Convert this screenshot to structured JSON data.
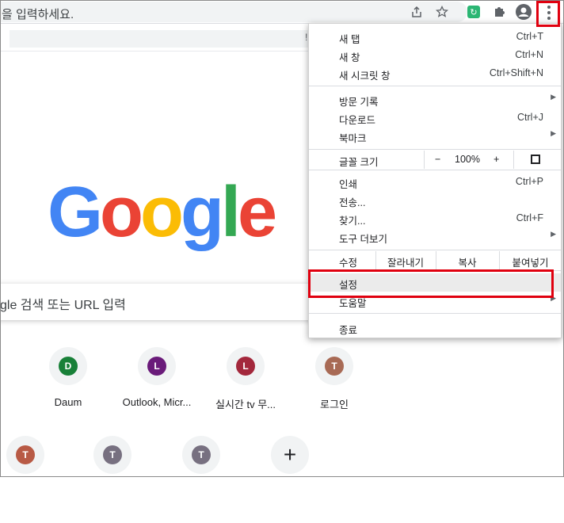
{
  "omnibox": {
    "placeholder_text": "을 입력하세요.",
    "icons": [
      "share-icon",
      "star-icon",
      "extension-green-icon",
      "puzzle-icon",
      "profile-icon",
      "kebab-menu-icon"
    ]
  },
  "bookmarks_bar": {
    "overflow_text": "!"
  },
  "google_logo": {
    "letters": [
      "G",
      "o",
      "o",
      "g",
      "l",
      "e"
    ],
    "colors": [
      "#4285f4",
      "#ea4335",
      "#fbbc05",
      "#4285f4",
      "#34a853",
      "#ea4335"
    ]
  },
  "search": {
    "placeholder": "gle 검색 또는 URL 입력"
  },
  "shortcuts": [
    {
      "letter": "D",
      "label": "Daum",
      "color": "#188038"
    },
    {
      "letter": "L",
      "label": "Outlook, Micr...",
      "color": "#6a1b7a"
    },
    {
      "letter": "L",
      "label": "실시간 tv 무...",
      "color": "#a3283c"
    },
    {
      "letter": "T",
      "label": "로그인",
      "color": "#a86a55"
    },
    {
      "letter": "T",
      "label": "",
      "color": "#b85a45"
    },
    {
      "letter": "T",
      "label": "",
      "color": "#777080"
    },
    {
      "letter": "T",
      "label": "",
      "color": "#777080"
    },
    {
      "letter": "+",
      "label": "",
      "color": ""
    }
  ],
  "menu": {
    "new_tab": {
      "label": "새 탭",
      "shortcut": "Ctrl+T"
    },
    "new_window": {
      "label": "새 창",
      "shortcut": "Ctrl+N"
    },
    "incognito": {
      "label": "새 시크릿 창",
      "shortcut": "Ctrl+Shift+N"
    },
    "history": {
      "label": "방문 기록"
    },
    "downloads": {
      "label": "다운로드",
      "shortcut": "Ctrl+J"
    },
    "bookmarks": {
      "label": "북마크"
    },
    "zoom": {
      "label": "글꼴 크기",
      "minus": "−",
      "value": "100%",
      "plus": "+"
    },
    "print": {
      "label": "인쇄",
      "shortcut": "Ctrl+P"
    },
    "cast": {
      "label": "전송..."
    },
    "find": {
      "label": "찾기...",
      "shortcut": "Ctrl+F"
    },
    "more_tools": {
      "label": "도구 더보기"
    },
    "edit": {
      "label": "수정",
      "cut": "잘라내기",
      "copy": "복사",
      "paste": "붙여넣기"
    },
    "settings": {
      "label": "설정"
    },
    "help": {
      "label": "도움말"
    },
    "exit": {
      "label": "종료"
    }
  },
  "highlight_color": "#e0000f"
}
